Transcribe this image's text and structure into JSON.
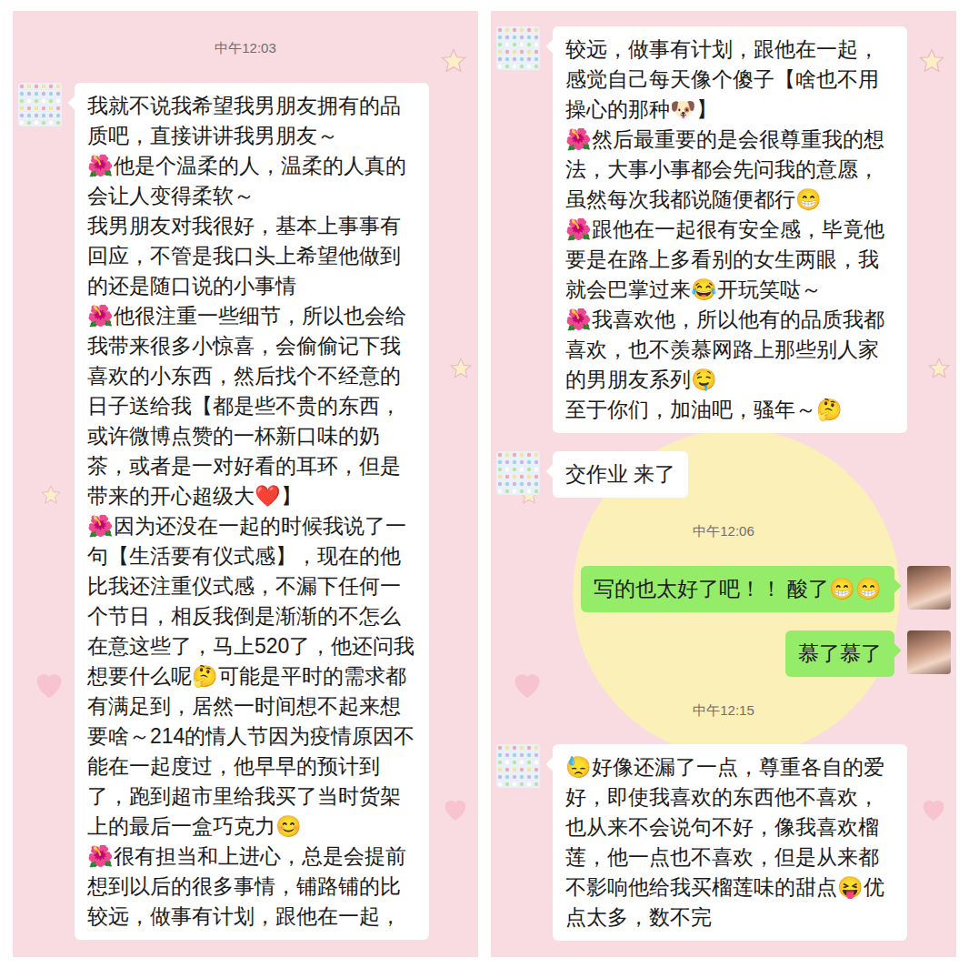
{
  "panels": [
    {
      "anchor": "top",
      "messages": [
        {
          "kind": "time",
          "text": "中午12:03"
        },
        {
          "kind": "bubble",
          "from": "friend",
          "paragraphs": [
            "我就不说我希望我男朋友拥有的品质吧，直接讲讲我男朋友～",
            "🌺他是个温柔的人，温柔的人真的会让人变得柔软～",
            "我男朋友对我很好，基本上事事有回应，不管是我口头上希望他做到的还是随口说的小事情",
            "🌺他很注重一些细节，所以也会给我带来很多小惊喜，会偷偷记下我喜欢的小东西，然后找个不经意的日子送给我【都是些不贵的东西，或许微博点赞的一杯新口味的奶茶，或者是一对好看的耳环，但是带来的开心超级大❤️】",
            "🌺因为还没在一起的时候我说了一句【生活要有仪式感】，现在的他比我还注重仪式感，不漏下任何一个节日，相反我倒是渐渐的不怎么在意这些了，马上520了，他还问我想要什么呢🤔可能是平时的需求都有满足到，居然一时间想不起来想要啥～214的情人节因为疫情原因不能在一起度过，他早早的预计到了，跑到超市里给我买了当时货架上的最后一盒巧克力😊",
            "🌺很有担当和上进心，总是会提前想到以后的很多事情，铺路铺的比较远，做事有计划，跟他在一起，"
          ]
        }
      ]
    },
    {
      "anchor": "bottom",
      "messages": [
        {
          "kind": "bubble",
          "from": "friend",
          "paragraphs": [
            "较远，做事有计划，跟他在一起，感觉自己每天像个傻子【啥也不用操心的那种🐶】",
            "🌺然后最重要的是会很尊重我的想法，大事小事都会先问我的意愿，虽然每次我都说随便都行😁",
            "🌺跟他在一起很有安全感，毕竟他要是在路上多看别的女生两眼，我就会巴掌过来😂开玩笑哒～",
            "🌺我喜欢他，所以他有的品质我都喜欢，也不羡慕网路上那些别人家的男朋友系列🤤",
            "至于你们，加油吧，骚年～🤔"
          ]
        },
        {
          "kind": "bubble",
          "from": "friend",
          "paragraphs": [
            "交作业 来了"
          ]
        },
        {
          "kind": "time",
          "text": "中午12:06"
        },
        {
          "kind": "bubble",
          "from": "me",
          "paragraphs": [
            "写的也太好了吧！！ 酸了😁😁"
          ]
        },
        {
          "kind": "bubble",
          "from": "me",
          "paragraphs": [
            "慕了慕了"
          ]
        },
        {
          "kind": "time",
          "text": "中午12:15"
        },
        {
          "kind": "bubble",
          "from": "friend",
          "paragraphs": [
            "😓好像还漏了一点，尊重各自的爱好，即使我喜欢的东西他不喜欢，也从来不会说句不好，像我喜欢榴莲，他一点也不喜欢，但是从来都不影响他给我买榴莲味的甜点😝优点太多，数不完"
          ]
        }
      ]
    }
  ]
}
